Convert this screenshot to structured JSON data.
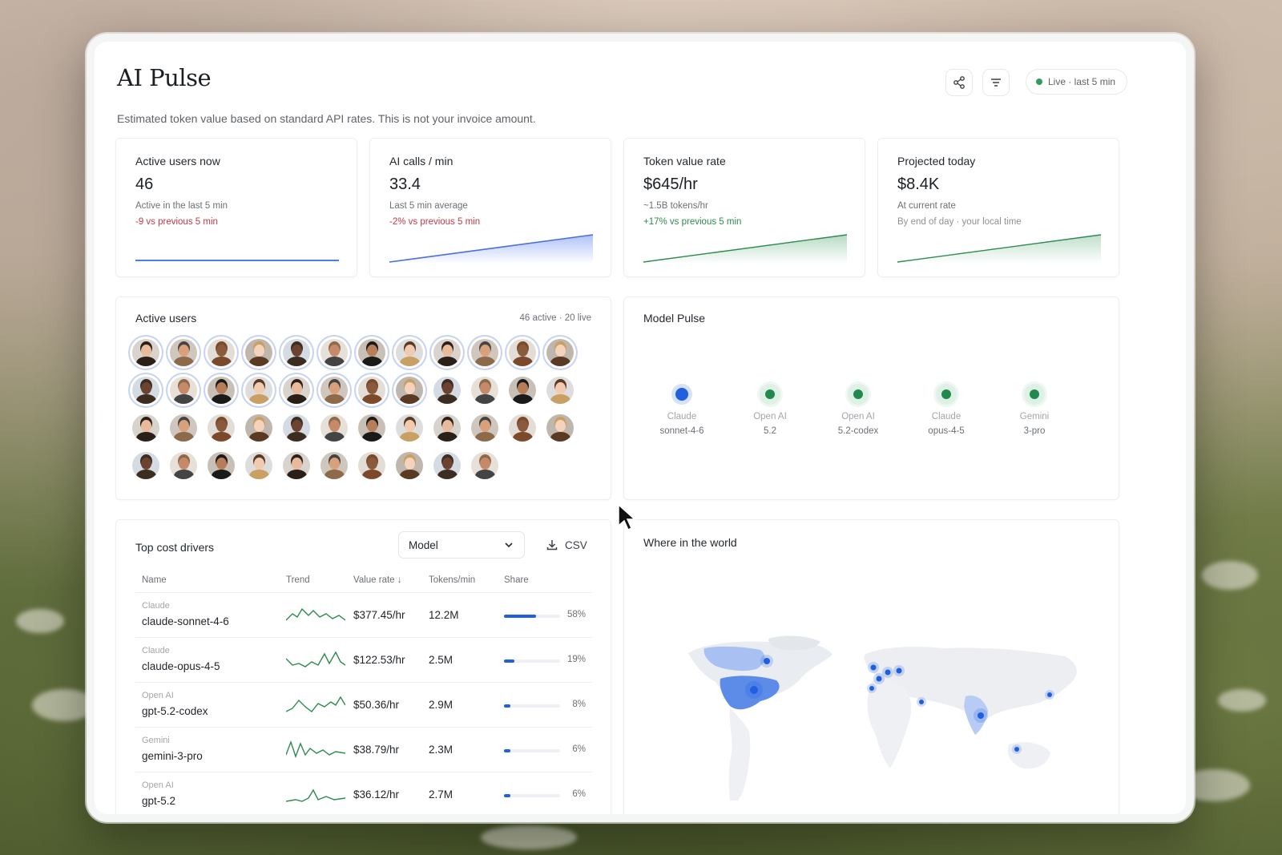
{
  "header": {
    "title": "AI Pulse",
    "subtitle": "Estimated token value based on standard API rates. This is not your invoice amount.",
    "share_icon": "share-icon",
    "filter_icon": "filter-icon",
    "live_label": "Live · last 5 min"
  },
  "stats": [
    {
      "label": "Active users now",
      "value": "46",
      "note": "Active in the last 5 min",
      "delta": "-9 vs previous 5 min",
      "delta_tone": "negative"
    },
    {
      "label": "AI calls / min",
      "value": "33.4",
      "note": "Last 5 min average",
      "delta": "-2% vs previous 5 min",
      "delta_tone": "negative"
    },
    {
      "label": "Token value rate",
      "value": "$645/hr",
      "note": "~1.5B tokens/hr",
      "delta": "+17% vs previous 5 min",
      "delta_tone": "positive"
    },
    {
      "label": "Projected today",
      "value": "$8.4K",
      "note": "At current rate",
      "delta": "By end of day · your local time",
      "delta_tone": "muted"
    }
  ],
  "active_users": {
    "title": "Active users",
    "meta": "46 active · 20 live",
    "count": 46,
    "live_count": 20
  },
  "model_pulse": {
    "title": "Model Pulse",
    "models": [
      {
        "provider": "Claude",
        "model": "sonnet-4-6",
        "color": "#1f5fe0"
      },
      {
        "provider": "Open AI",
        "model": "5.2",
        "color": "#1f8a4c"
      },
      {
        "provider": "Open AI",
        "model": "5.2-codex",
        "color": "#1f8a4c"
      },
      {
        "provider": "Claude",
        "model": "opus-4-5",
        "color": "#1f8a4c"
      },
      {
        "provider": "Gemini",
        "model": "3-pro",
        "color": "#1f8a4c"
      }
    ]
  },
  "cost_drivers": {
    "title": "Top cost drivers",
    "dropdown_value": "Model",
    "csv_label": "CSV",
    "columns": {
      "name": "Name",
      "trend": "Trend",
      "rate": "Value rate ↓",
      "tokens": "Tokens/min",
      "share": "Share"
    },
    "rows": [
      {
        "provider": "Claude",
        "model": "claude-sonnet-4-6",
        "rate": "$377.45/hr",
        "tokens": "12.2M",
        "share": "58%",
        "share_value": 0.58
      },
      {
        "provider": "Claude",
        "model": "claude-opus-4-5",
        "rate": "$122.53/hr",
        "tokens": "2.5M",
        "share": "19%",
        "share_value": 0.19
      },
      {
        "provider": "Open AI",
        "model": "gpt-5.2-codex",
        "rate": "$50.36/hr",
        "tokens": "2.9M",
        "share": "8%",
        "share_value": 0.08
      },
      {
        "provider": "Gemini",
        "model": "gemini-3-pro",
        "rate": "$38.79/hr",
        "tokens": "2.3M",
        "share": "6%",
        "share_value": 0.06
      },
      {
        "provider": "Open AI",
        "model": "gpt-5.2",
        "rate": "$36.12/hr",
        "tokens": "2.7M",
        "share": "6%",
        "share_value": 0.06
      }
    ]
  },
  "world": {
    "title": "Where in the world"
  },
  "colors": {
    "accent": "#1f5fe0",
    "positive": "#2e8a4f",
    "negative": "#c0394b",
    "live": "#2e9d5c"
  }
}
